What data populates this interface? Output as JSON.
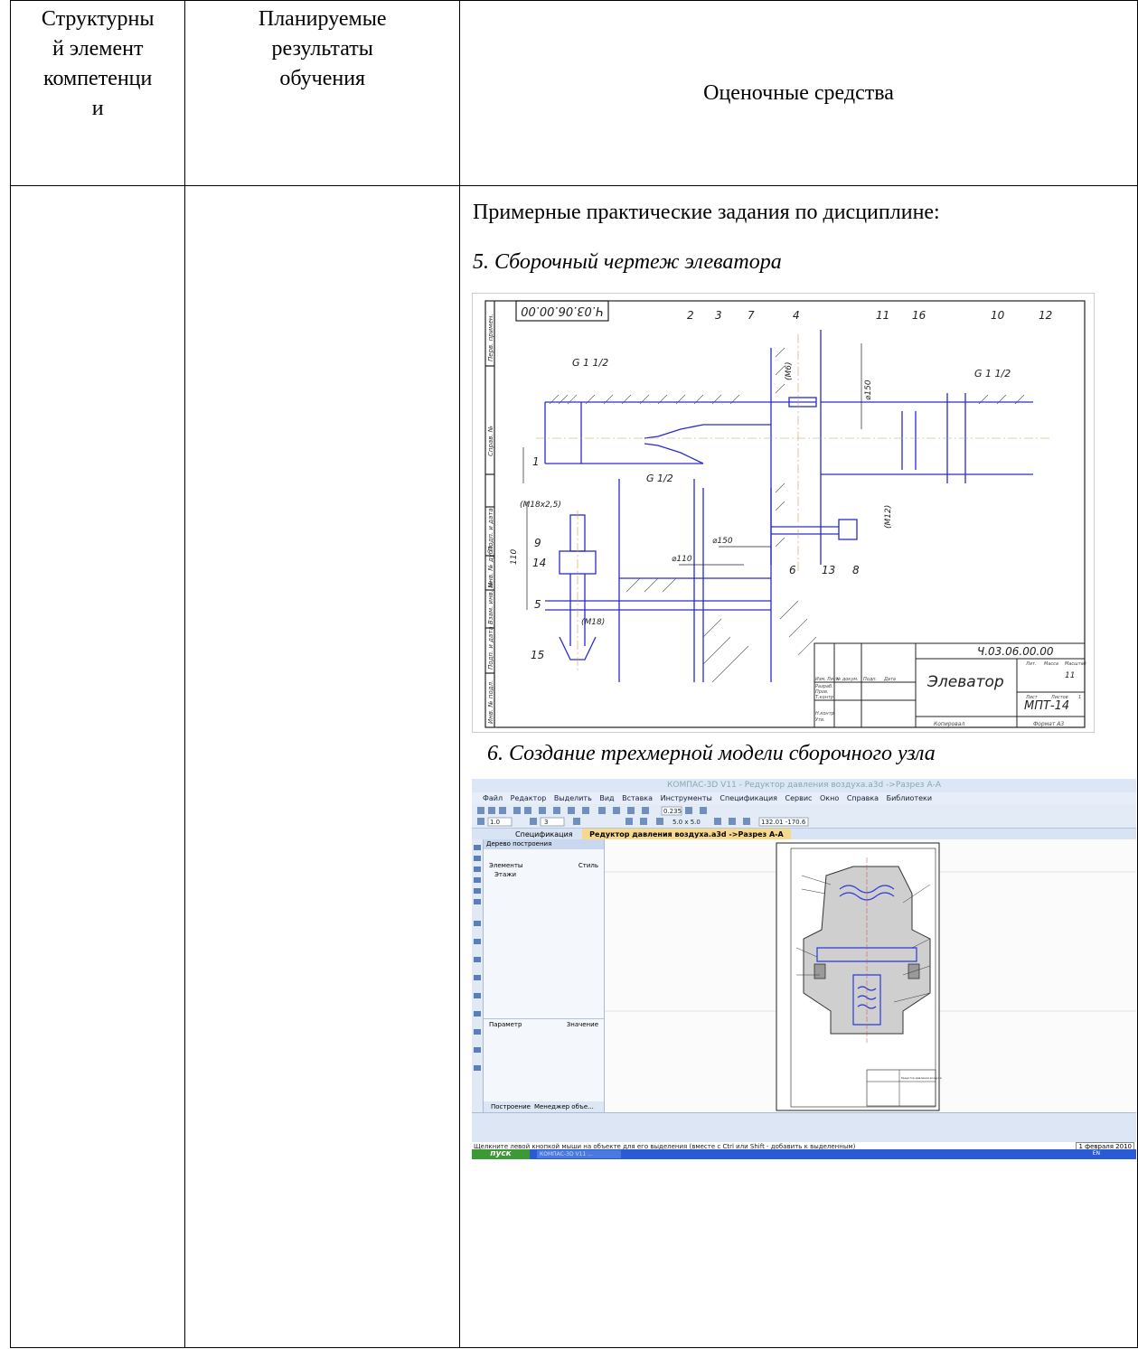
{
  "table": {
    "headers": {
      "structural_element": "Структурны\nй элемент\nкомпетенци\nи",
      "planned_results": "Планируемые\nрезультаты\nобучения",
      "assessment_tools": "Оценочные средства"
    },
    "intro": "Примерные практические задания по дисциплине:",
    "task5": "5. Сборочный чертеж элеватора",
    "task6": "6. Создание трехмерной модели сборочного узла"
  },
  "drawing": {
    "code_rotated": "Ч.03.06.00.00",
    "designation": "Ч.03.06.00.00",
    "name": "Элеватор",
    "group": "МПТ-14",
    "sheet_scale": "11",
    "copied": "Копировал",
    "format": "Формат А3",
    "callouts": [
      "2",
      "3",
      "7",
      "4",
      "11",
      "16",
      "10",
      "12",
      "1",
      "9",
      "14",
      "5",
      "15",
      "6",
      "13",
      "8"
    ],
    "dims": {
      "thread_left": "G 1 1/2",
      "thread_right": "G 1 1/2",
      "thread_nozzle": "G 1/2",
      "m18": "(М18х2,5)",
      "m18b": "(М18)",
      "m12": "(М12)",
      "m6": "(М6)",
      "d110": "⌀110",
      "d150a": "⌀150",
      "d150b": "⌀150",
      "h110": "110"
    },
    "title_block_labels": [
      "Изм.",
      "Лист",
      "№ докум.",
      "Подп.",
      "Дата",
      "Разраб.",
      "Пров.",
      "Т.контр.",
      "Н.контр.",
      "Утв.",
      "Лит.",
      "Масса",
      "Масштаб",
      "Лист",
      "Листов",
      "1"
    ],
    "side_labels": [
      "Перв. примен.",
      "Справ. №",
      "Подп. и дата",
      "Инв. № дубл.",
      "Взам. инв. №",
      "Подп. и дата",
      "Инв. № подл."
    ]
  },
  "kompas": {
    "window_title": "КОМПАС-3D V11 - Редуктор давления воздуха.a3d ->Разрез А-А",
    "menu": [
      "Файл",
      "Редактор",
      "Выделить",
      "Вид",
      "Вставка",
      "Инструменты",
      "Спецификация",
      "Сервис",
      "Окно",
      "Справка",
      "Библиотеки"
    ],
    "zoom": "0.235",
    "step": "1.0",
    "layer": "3",
    "grid": "5.0 x 5.0",
    "coords": "132.01  -170.6",
    "tabs": [
      "Спецификация",
      "Редуктор давления воздуха.a3d ->Разрез А-А"
    ],
    "tree_title": "Дерево построения",
    "tree_cols": [
      "Элементы",
      "Стиль"
    ],
    "tree_item": "Этажи",
    "param_cols": [
      "Параметр",
      "Значение"
    ],
    "panel_tabs": [
      "Построение",
      "Менеджер объе..."
    ],
    "status": "Щелкните левой кнопкой мыши на объекте для его выделения (вместе с Ctrl или Shift - добавить к выделенным)",
    "date": "1 февраля 2010",
    "start": "пуск",
    "taskbar_item": "КОМПАС-3D V11 ...",
    "lang": "EN",
    "tb_title": "Редуктор давления воздуха"
  }
}
